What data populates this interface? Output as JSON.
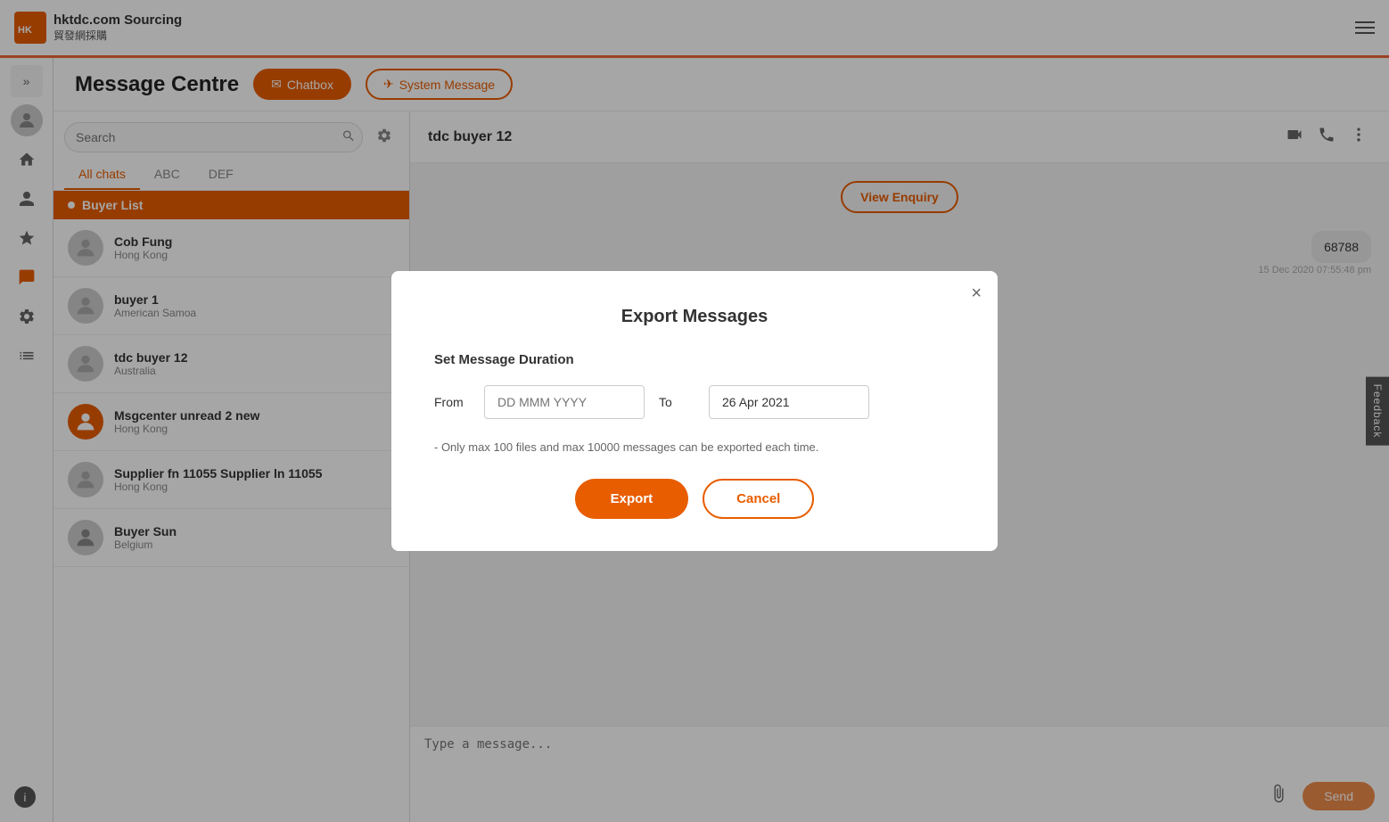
{
  "topbar": {
    "brand_name": "hktdc.com Sourcing",
    "brand_sub": "貿發網採購",
    "hamburger_label": "menu"
  },
  "page": {
    "title": "Message Centre",
    "tabs": [
      {
        "id": "chatbox",
        "label": "Chatbox",
        "active": true
      },
      {
        "id": "system",
        "label": "System Message",
        "active": false
      }
    ]
  },
  "search": {
    "placeholder": "Search",
    "value": ""
  },
  "chat_tabs": [
    {
      "id": "all",
      "label": "All chats",
      "active": true
    },
    {
      "id": "abc",
      "label": "ABC",
      "active": false
    },
    {
      "id": "def",
      "label": "DEF",
      "active": false
    }
  ],
  "section": {
    "label": "Buyer List"
  },
  "contacts": [
    {
      "name": "Cob Fung",
      "location": "Hong Kong"
    },
    {
      "name": "buyer 1",
      "location": "American Samoa"
    },
    {
      "name": "tdc buyer 12",
      "location": "Australia"
    },
    {
      "name": "Msgcenter unread 2 new",
      "location": "Hong Kong"
    },
    {
      "name": "Supplier fn 11055 Supplier ln 11055",
      "location": "Hong Kong"
    },
    {
      "name": "Buyer Sun",
      "location": "Belgium"
    }
  ],
  "chat_header": {
    "name": "tdc buyer 12"
  },
  "view_enquiry": {
    "label": "View Enquiry"
  },
  "messages": [
    {
      "text": "68788",
      "time": "15 Dec 2020 07:55:48 pm",
      "align": "right"
    }
  ],
  "input": {
    "placeholder": "Type a message..."
  },
  "send_btn": "Send",
  "feedback": "Feedback",
  "info": "i",
  "modal": {
    "title": "Export Messages",
    "section_label": "Set Message Duration",
    "from_label": "From",
    "to_label": "To",
    "from_placeholder": "DD MMM YYYY",
    "to_value": "26 Apr 2021",
    "note": "- Only max 100 files and max 10000 messages can be exported each time.",
    "export_btn": "Export",
    "cancel_btn": "Cancel",
    "close_btn": "×"
  }
}
